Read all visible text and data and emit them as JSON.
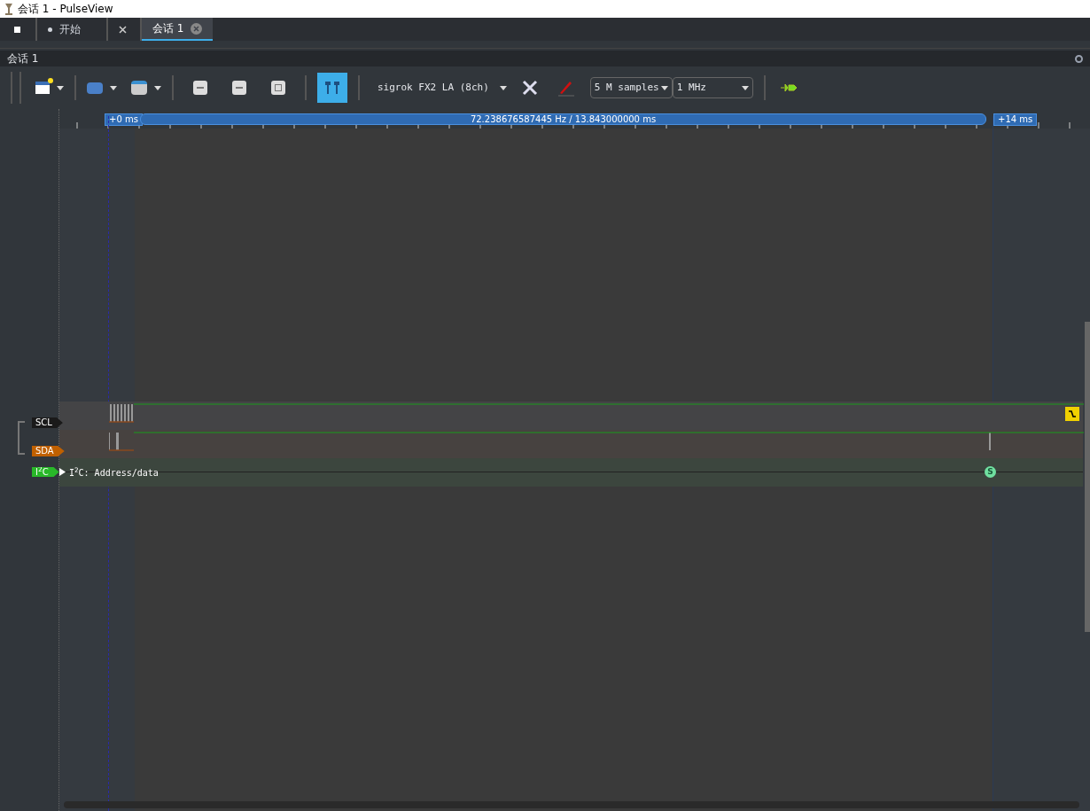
{
  "window": {
    "title": "会话 1 - PulseView"
  },
  "tabs": [
    {
      "kind": "stop",
      "selected": false
    },
    {
      "kind": "start",
      "label": "开始",
      "selected": false
    },
    {
      "kind": "tools",
      "selected": false
    },
    {
      "kind": "session",
      "label": "会话 1",
      "selected": true
    }
  ],
  "session": {
    "title": "会话 1"
  },
  "toolbar": {
    "device": "sigrok FX2 LA (8ch)",
    "samples": "5 M samples",
    "rate": "1 MHz"
  },
  "ruler": {
    "start": "+0 ms",
    "measure": "72.238676587445 Hz / 13.843000000 ms",
    "end": "+14 ms"
  },
  "channels": [
    {
      "name": "SCL",
      "color": "#1a1a1a"
    },
    {
      "name": "SDA",
      "color": "#c06000"
    }
  ],
  "decoder": {
    "tag": "I$^{2}$C",
    "color": "#29b829",
    "row": "I$^{2}$C: Address/data",
    "expanded": false,
    "annotation": "S"
  }
}
